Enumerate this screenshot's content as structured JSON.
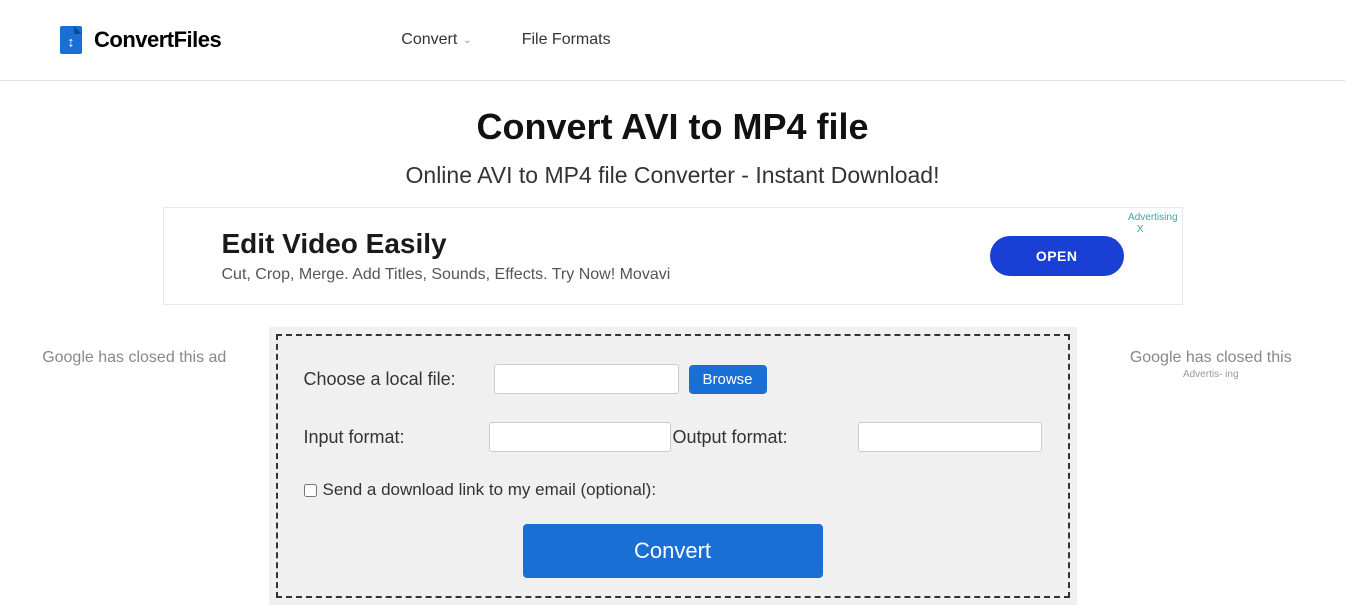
{
  "header": {
    "logo_text": "ConvertFiles",
    "nav": {
      "convert": "Convert",
      "file_formats": "File Formats"
    }
  },
  "page": {
    "title": "Convert AVI to MP4 file",
    "subtitle": "Online AVI to MP4 file Converter - Instant Download!"
  },
  "ad_banner": {
    "title": "Edit Video Easily",
    "subtitle": "Cut, Crop, Merge. Add Titles, Sounds, Effects. Try Now! Movavi",
    "button": "OPEN",
    "label": "Advertising",
    "close": "X"
  },
  "side_left": {
    "text": "Google has closed this ad"
  },
  "side_right": {
    "text": "Google has closed this",
    "small": "Advertis-\ning"
  },
  "form": {
    "choose_file_label": "Choose a local file:",
    "browse_button": "Browse",
    "input_format_label": "Input format:",
    "output_format_label": "Output format:",
    "email_checkbox_label": "Send a download link to my email (optional):",
    "convert_button": "Convert"
  }
}
